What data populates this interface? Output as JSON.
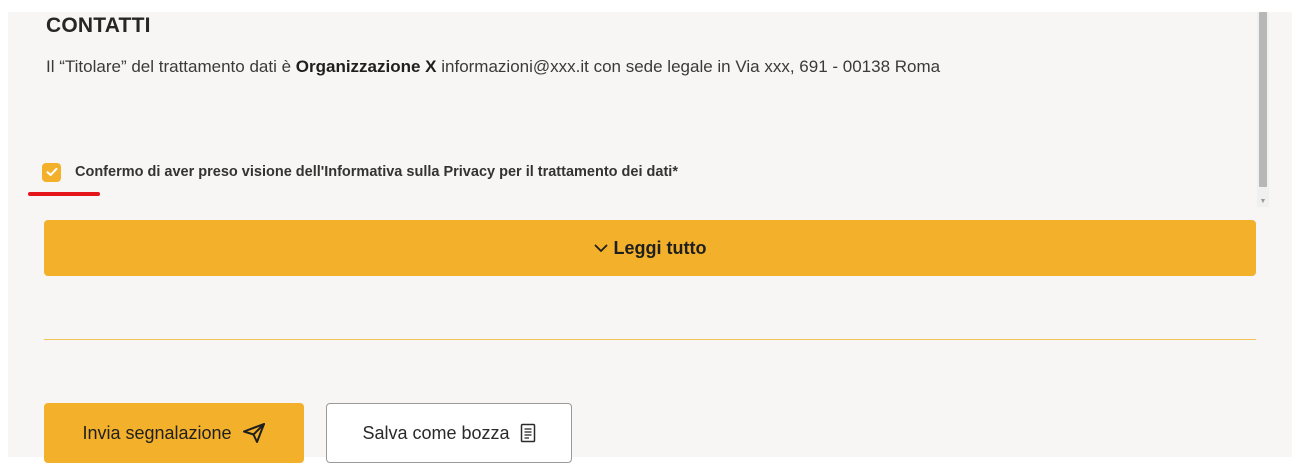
{
  "contacts": {
    "title": "CONTATTI",
    "text_before": "Il “Titolare” del trattamento dati è ",
    "organization": "Organizzazione X",
    "text_after": " informazioni@xxx.it con sede legale in Via xxx, 691 - 00138 Roma"
  },
  "consent": {
    "checked": true,
    "label": "Confermo di aver preso visione dell'Informativa sulla Privacy per il trattamento dei dati*"
  },
  "read_more": {
    "label": "Leggi tutto",
    "icon": "chevron-down-icon"
  },
  "actions": {
    "submit_label": "Invia segnalazione",
    "submit_icon": "send-icon",
    "draft_label": "Salva come bozza",
    "draft_icon": "document-icon"
  },
  "colors": {
    "accent": "#f3b02a",
    "annotation": "#e5151b",
    "background": "#f7f6f4"
  }
}
